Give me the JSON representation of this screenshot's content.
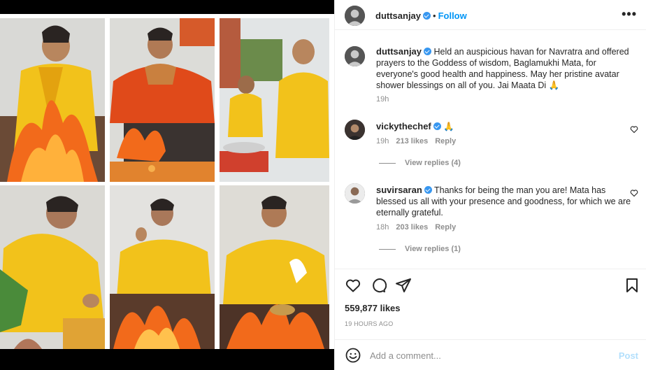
{
  "post": {
    "author": "duttsanjay",
    "follow_label": "Follow",
    "dot": "•",
    "more": "•••",
    "caption": "Held an auspicious havan for Navratra and offered prayers to the Goddess of wisdom, Baglamukhi Mata, for everyone's good health and happiness. May her pristine avatar shower blessings on all of you. Jai Maata Di 🙏",
    "caption_age": "19h",
    "likes": "559,877 likes",
    "posted": "19 HOURS AGO",
    "add_comment_placeholder": "Add a comment...",
    "post_label": "Post"
  },
  "comments": [
    {
      "user": "vickythechef",
      "text": "🙏",
      "age": "19h",
      "likes": "213 likes",
      "reply": "Reply",
      "view_replies": "View replies (4)"
    },
    {
      "user": "suvirsaran",
      "text": "Thanks for being the man you are! Mata has blessed us all with your presence and goodness, for which we are eternally grateful.",
      "age": "18h",
      "likes": "203 likes",
      "reply": "Reply",
      "view_replies": "View replies (1)"
    }
  ],
  "colors": {
    "accent": "#0095f6",
    "verified": "#3897f0",
    "robe": "#f2c21b",
    "fire": "#f26a1b"
  }
}
